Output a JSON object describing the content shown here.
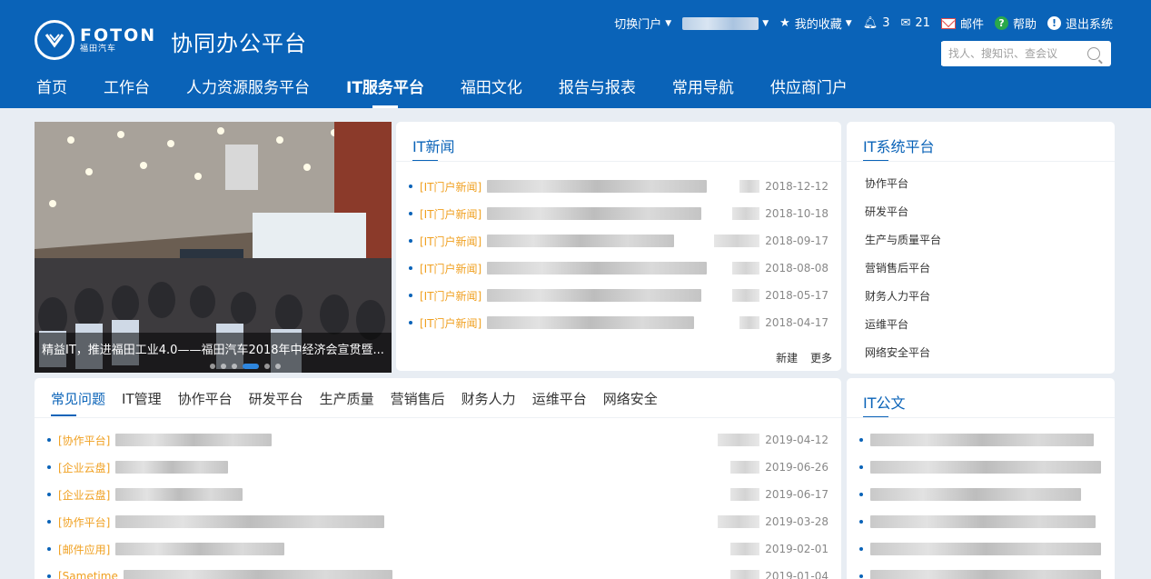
{
  "brand": {
    "logo_name": "FOTON",
    "logo_sub": "福田汽车",
    "site_title": "协同办公平台"
  },
  "topbar": {
    "switch_portal": "切换门户",
    "favorites": "我的收藏",
    "notifications": "3",
    "messages": "21",
    "mail": "邮件",
    "help": "帮助",
    "logout": "退出系统"
  },
  "search": {
    "placeholder": "找人、搜知识、查会议"
  },
  "nav": [
    {
      "label": "首页"
    },
    {
      "label": "工作台"
    },
    {
      "label": "人力资源服务平台"
    },
    {
      "label": "IT服务平台",
      "active": true
    },
    {
      "label": "福田文化"
    },
    {
      "label": "报告与报表"
    },
    {
      "label": "常用导航"
    },
    {
      "label": "供应商门户"
    }
  ],
  "banner": {
    "caption": "精益IT，推进福田工业4.0——福田汽车2018年中经济会宣贯暨...",
    "slides": 6,
    "active_slide": 4
  },
  "it_news": {
    "title": "IT新闻",
    "items": [
      {
        "tag": "[IT门户新闻]",
        "date": "2018-12-12"
      },
      {
        "tag": "[IT门户新闻]",
        "date": "2018-10-18"
      },
      {
        "tag": "[IT门户新闻]",
        "date": "2018-09-17"
      },
      {
        "tag": "[IT门户新闻]",
        "date": "2018-08-08"
      },
      {
        "tag": "[IT门户新闻]",
        "date": "2018-05-17"
      },
      {
        "tag": "[IT门户新闻]",
        "date": "2018-04-17"
      }
    ],
    "new_label": "新建",
    "more_label": "更多"
  },
  "it_systems": {
    "title": "IT系统平台",
    "items": [
      "协作平台",
      "研发平台",
      "生产与质量平台",
      "营销售后平台",
      "财务人力平台",
      "运维平台",
      "网络安全平台"
    ]
  },
  "faq": {
    "tabs": [
      "常见问题",
      "IT管理",
      "协作平台",
      "研发平台",
      "生产质量",
      "营销售后",
      "财务人力",
      "运维平台",
      "网络安全"
    ],
    "items": [
      {
        "tag": "[协作平台]",
        "date": "2019-04-12"
      },
      {
        "tag": "[企业云盘]",
        "date": "2019-06-26"
      },
      {
        "tag": "[企业云盘]",
        "date": "2019-06-17"
      },
      {
        "tag": "[协作平台]",
        "date": "2019-03-28"
      },
      {
        "tag": "[邮件应用]",
        "date": "2019-02-01"
      },
      {
        "tag": "[Sametime",
        "date": "2019-01-04"
      }
    ]
  },
  "it_docs": {
    "title": "IT公文"
  },
  "colors": {
    "header": "#0a63b8",
    "tag": "#f0a020",
    "background": "#e8edf3"
  }
}
